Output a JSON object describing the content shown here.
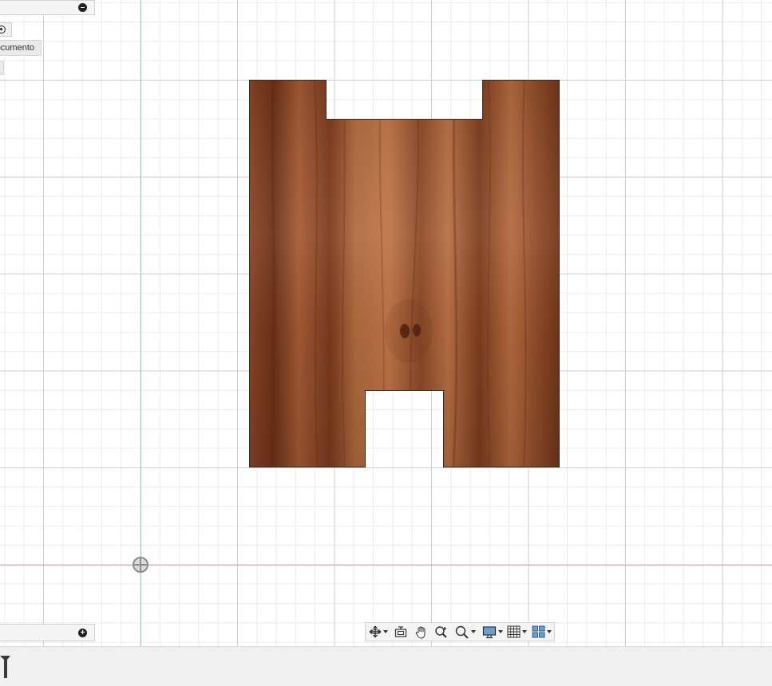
{
  "browser_panel": {
    "document_tab_label": "ocumento"
  },
  "viewport": {
    "part_material": "wood",
    "colors": {
      "wood_base": "#9a5330",
      "wood_dark": "#6b3318",
      "wood_light": "#c77a4c",
      "grid_major": "#cfcfcf",
      "grid_minor": "#ececec",
      "axis_green": "#9be3a7",
      "axis_red": "#f2a0a0"
    }
  },
  "navigation_bar": {
    "tools": [
      {
        "name": "orbit-icon",
        "has_dropdown": true
      },
      {
        "name": "look-at-icon",
        "has_dropdown": false
      },
      {
        "name": "pan-hand-icon",
        "has_dropdown": false
      },
      {
        "name": "zoom-icon",
        "has_dropdown": false
      },
      {
        "name": "zoom-window-icon",
        "has_dropdown": true
      },
      {
        "name": "display-settings-icon",
        "has_dropdown": true
      },
      {
        "name": "grid-settings-icon",
        "has_dropdown": true
      },
      {
        "name": "viewports-icon",
        "has_dropdown": true
      }
    ]
  }
}
